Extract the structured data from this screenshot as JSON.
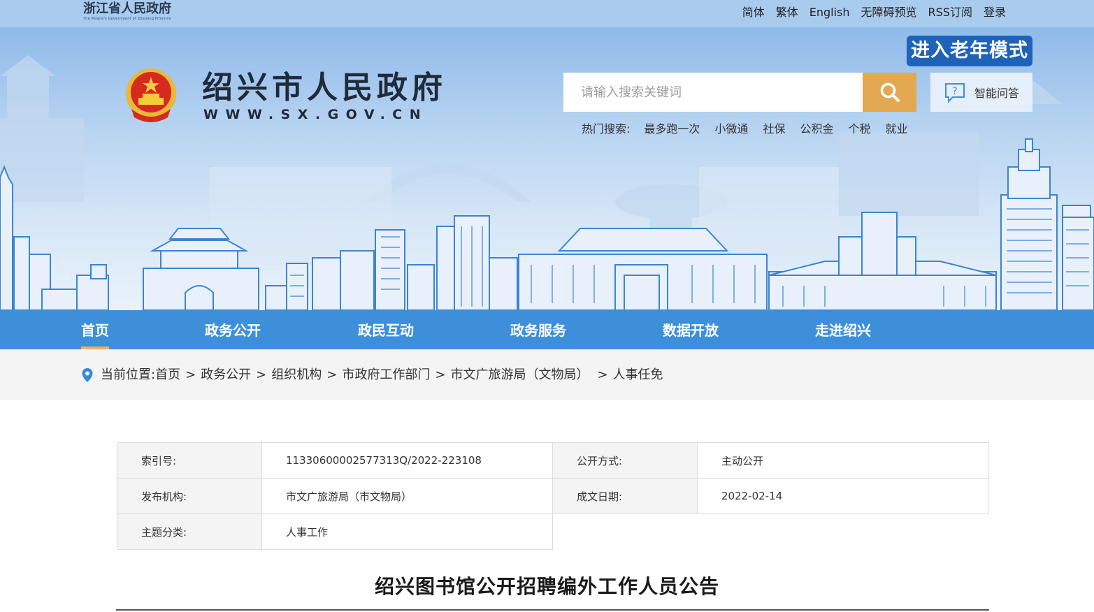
{
  "top": {
    "province_logo_cn": "浙江省人民政府",
    "province_logo_en": "The People's Government of Zhejiang Province",
    "links": [
      "简体",
      "繁体",
      "English",
      "无障碍预览",
      "RSS订阅",
      "登录"
    ]
  },
  "header": {
    "site_name": "绍兴市人民政府",
    "site_url": "WWW.SX.GOV.CN",
    "elder_mode": "进入老年模式",
    "search_placeholder": "请输入搜索关键词",
    "qa_label": "智能问答",
    "hot_label": "热门搜索:",
    "hot_items": [
      "最多跑一次",
      "小微通",
      "社保",
      "公积金",
      "个税",
      "就业"
    ]
  },
  "nav": [
    "首页",
    "政务公开",
    "政民互动",
    "政务服务",
    "数据开放",
    "走进绍兴"
  ],
  "breadcrumb": {
    "label": "当前位置:",
    "items": [
      "首页",
      "政务公开",
      "组织机构",
      "市政府工作部门",
      "市文广旅游局（文物局）",
      "人事任免"
    ]
  },
  "meta": {
    "index_label": "索引号:",
    "index_value": "11330600002577313Q/2022-223108",
    "open_label": "公开方式:",
    "open_value": "主动公开",
    "org_label": "发布机构:",
    "org_value": "市文广旅游局（市文物局）",
    "date_label": "成文日期:",
    "date_value": "2022-02-14",
    "topic_label": "主题分类:",
    "topic_value": "人事工作"
  },
  "article": {
    "title": "绍兴图书馆公开招聘编外工作人员公告"
  },
  "colors": {
    "nav": "#3d8fd9",
    "accent": "#e3a852",
    "elder": "#1e63b7",
    "skyline": "#3b84d4"
  }
}
